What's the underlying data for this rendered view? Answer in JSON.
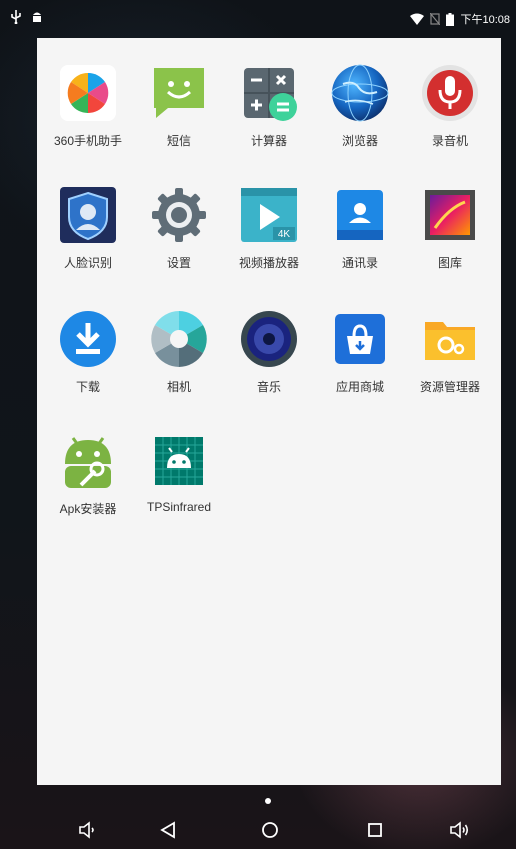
{
  "status_bar": {
    "time": "下午10:08",
    "left_icons": [
      "usb-icon",
      "android-debug-icon"
    ],
    "right_icons": [
      "wifi-icon",
      "no-sim-icon",
      "battery-icon"
    ]
  },
  "apps": [
    {
      "label": "360手机助手",
      "icon": "360-assistant-icon"
    },
    {
      "label": "短信",
      "icon": "messaging-icon"
    },
    {
      "label": "计算器",
      "icon": "calculator-icon"
    },
    {
      "label": "浏览器",
      "icon": "browser-icon"
    },
    {
      "label": "录音机",
      "icon": "recorder-icon"
    },
    {
      "label": "人脸识别",
      "icon": "face-recognition-icon"
    },
    {
      "label": "设置",
      "icon": "settings-icon"
    },
    {
      "label": "视频播放器",
      "icon": "video-player-icon"
    },
    {
      "label": "通讯录",
      "icon": "contacts-icon"
    },
    {
      "label": "图库",
      "icon": "gallery-icon"
    },
    {
      "label": "下载",
      "icon": "download-icon"
    },
    {
      "label": "相机",
      "icon": "camera-icon"
    },
    {
      "label": "音乐",
      "icon": "music-icon"
    },
    {
      "label": "应用商城",
      "icon": "app-store-icon"
    },
    {
      "label": "资源管理器",
      "icon": "file-manager-icon"
    },
    {
      "label": "Apk安装器",
      "icon": "apk-installer-icon"
    },
    {
      "label": "TPSinfrared",
      "icon": "tpsinfrared-icon"
    }
  ],
  "video_badge": "4K",
  "nav_bar": {
    "buttons": [
      "volume-down-icon",
      "back-icon",
      "home-icon",
      "recents-icon",
      "volume-up-icon"
    ]
  }
}
